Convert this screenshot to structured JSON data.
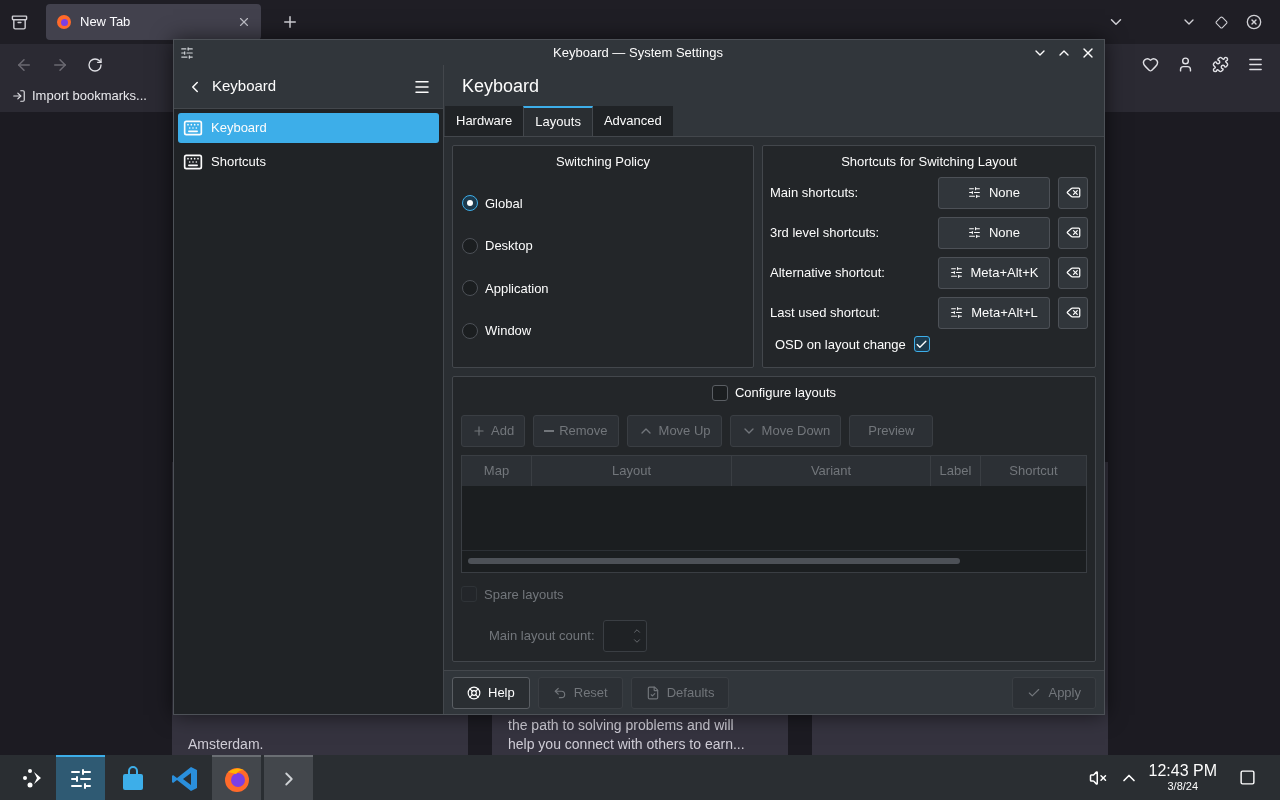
{
  "browser": {
    "tab": {
      "title": "New Tab"
    },
    "bookmarks": [
      "Import bookmarks..."
    ],
    "page_cards": [
      {
        "lines": [
          "Amsterdam."
        ]
      },
      {
        "lines": [
          "the path to solving problems and will",
          "help you connect with others to earn..."
        ]
      }
    ]
  },
  "window": {
    "title": "Keyboard — System Settings",
    "sidebar": {
      "header": "Keyboard",
      "items": [
        {
          "label": "Keyboard",
          "selected": true
        },
        {
          "label": "Shortcuts",
          "selected": false
        }
      ]
    },
    "page_title": "Keyboard",
    "tabs": [
      {
        "label": "Hardware",
        "selected": false
      },
      {
        "label": "Layouts",
        "selected": true
      },
      {
        "label": "Advanced",
        "selected": false
      }
    ],
    "switching_policy": {
      "title": "Switching Policy",
      "options": [
        {
          "label": "Global",
          "selected": true
        },
        {
          "label": "Desktop",
          "selected": false
        },
        {
          "label": "Application",
          "selected": false
        },
        {
          "label": "Window",
          "selected": false
        }
      ]
    },
    "shortcuts": {
      "title": "Shortcuts for Switching Layout",
      "rows": [
        {
          "label": "Main shortcuts:",
          "value": "None"
        },
        {
          "label": "3rd level shortcuts:",
          "value": "None"
        },
        {
          "label": "Alternative shortcut:",
          "value": "Meta+Alt+K"
        },
        {
          "label": "Last used shortcut:",
          "value": "Meta+Alt+L"
        }
      ],
      "osd": {
        "label": "OSD on layout change",
        "checked": true
      }
    },
    "layouts": {
      "configure": {
        "label": "Configure layouts",
        "checked": false
      },
      "buttons": [
        {
          "label": "Add",
          "kind": "add",
          "disabled": true
        },
        {
          "label": "Remove",
          "kind": "remove",
          "disabled": true
        },
        {
          "label": "Move Up",
          "kind": "up",
          "disabled": true
        },
        {
          "label": "Move Down",
          "kind": "down",
          "disabled": true
        },
        {
          "label": "Preview",
          "kind": "plain",
          "disabled": true
        }
      ],
      "columns": [
        "Map",
        "Layout",
        "Variant",
        "Label",
        "Shortcut"
      ],
      "spare": {
        "label": "Spare layouts",
        "checked": false,
        "disabled": true
      },
      "main_layout_count": {
        "label": "Main layout count:",
        "disabled": true
      }
    },
    "footer": [
      {
        "label": "Help",
        "kind": "help",
        "disabled": false
      },
      {
        "label": "Reset",
        "kind": "reset",
        "disabled": true
      },
      {
        "label": "Defaults",
        "kind": "defaults",
        "disabled": true
      },
      {
        "label": "Apply",
        "kind": "apply",
        "disabled": true
      }
    ]
  },
  "taskbar": {
    "apps": [
      {
        "kind": "settings",
        "selected": true
      },
      {
        "kind": "store",
        "selected": false,
        "running": false
      },
      {
        "kind": "code",
        "selected": false,
        "running": false
      },
      {
        "kind": "firefox",
        "selected": false,
        "running": true
      },
      {
        "kind": "terminal",
        "selected": false,
        "running": true
      }
    ],
    "clock": "12:43 PM",
    "date": "3/8/24"
  }
}
